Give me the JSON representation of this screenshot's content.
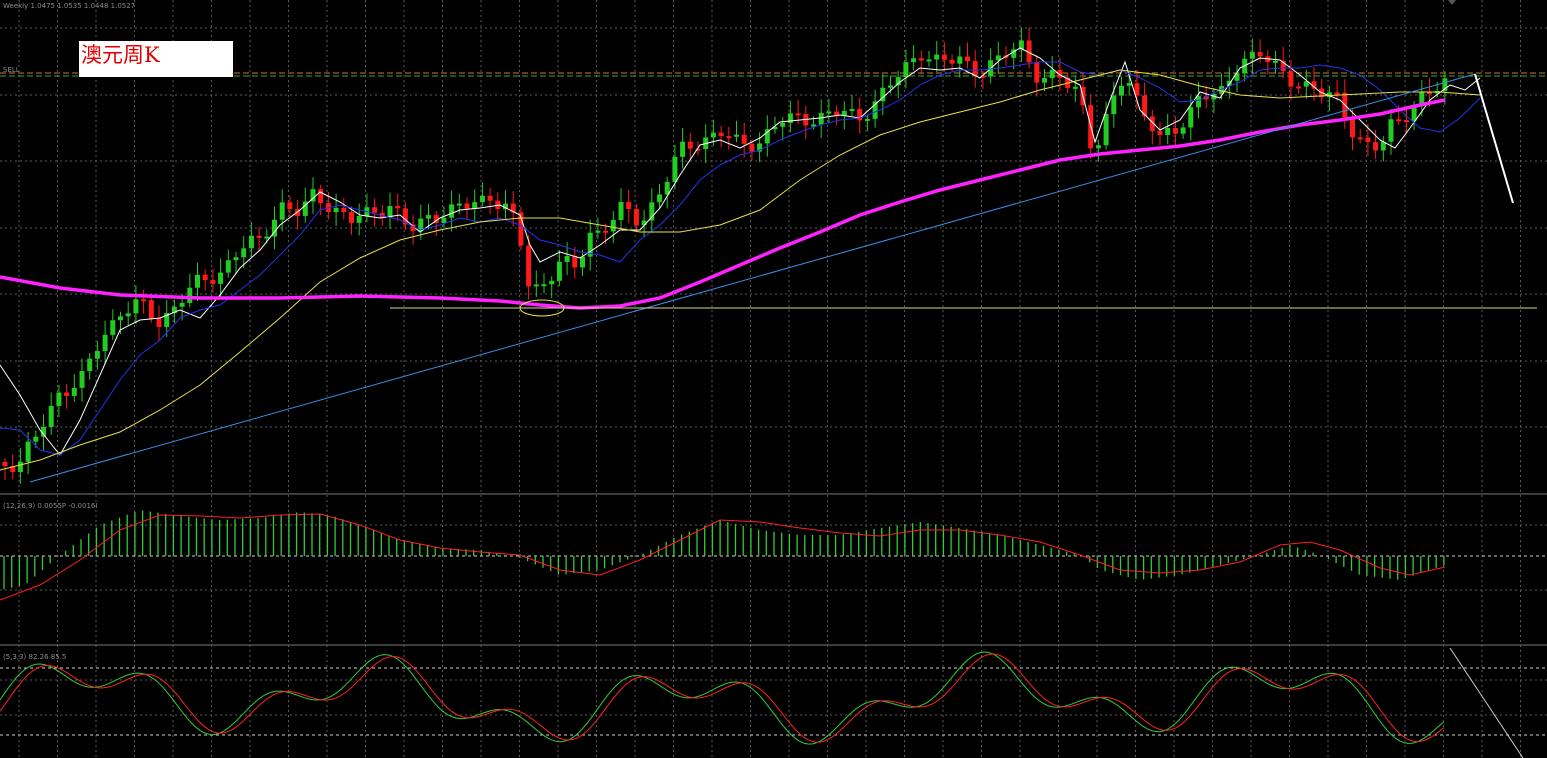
{
  "window": {
    "main_header": "Weekly  1.0475 1.0535 1.0448 1.0527",
    "macd_header": "(12,26,9)  0.0055P  -0.0016I",
    "stoch_header": "(5,3,3)  82.26  85.5",
    "price_tag": "SELL"
  },
  "annotation": {
    "title": "澳元周K"
  },
  "colors": {
    "background": "#000000",
    "grid": "#5a5a5a",
    "bull_candle": "#22cc22",
    "bear_candle": "#ff1a1a",
    "ma_fast": "#ffffff",
    "ma_mid": "#2233ee",
    "ma_slow": "#e8e04a",
    "ma_long": "#ff22ff",
    "trendline": "#3a8fe6",
    "support_line": "#d9d29a",
    "level_line": "#c97a22",
    "macd_hist": "#33cc33",
    "macd_signal": "#ff2020",
    "stoch_main": "#33cc33",
    "stoch_signal": "#ff2020",
    "projection": "#ffffff"
  },
  "icons": [
    "price-scale-arrow-icon"
  ]
}
